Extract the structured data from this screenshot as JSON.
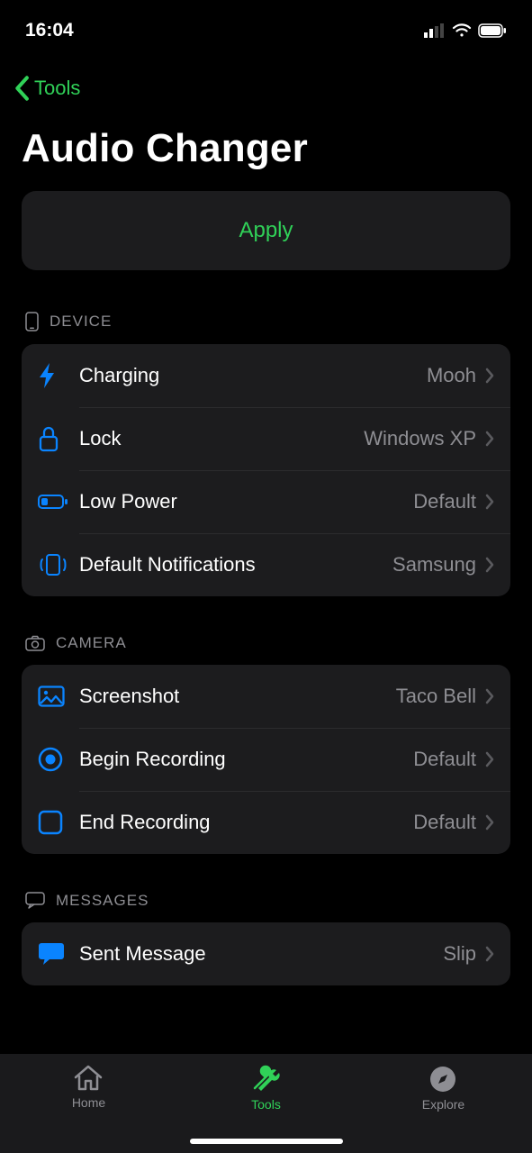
{
  "statusbar": {
    "time": "16:04"
  },
  "nav": {
    "back_label": "Tools"
  },
  "page": {
    "title": "Audio Changer",
    "apply_label": "Apply"
  },
  "sections": {
    "device": {
      "header": "DEVICE",
      "rows": {
        "charging": {
          "label": "Charging",
          "value": "Mooh"
        },
        "lock": {
          "label": "Lock",
          "value": "Windows XP"
        },
        "lowpower": {
          "label": "Low Power",
          "value": "Default"
        },
        "notif": {
          "label": "Default Notifications",
          "value": "Samsung"
        }
      }
    },
    "camera": {
      "header": "CAMERA",
      "rows": {
        "screenshot": {
          "label": "Screenshot",
          "value": "Taco Bell"
        },
        "begin_rec": {
          "label": "Begin Recording",
          "value": "Default"
        },
        "end_rec": {
          "label": "End Recording",
          "value": "Default"
        }
      }
    },
    "messages": {
      "header": "MESSAGES",
      "rows": {
        "sent": {
          "label": "Sent Message",
          "value": "Slip"
        }
      }
    }
  },
  "tabbar": {
    "home": {
      "label": "Home"
    },
    "tools": {
      "label": "Tools"
    },
    "explore": {
      "label": "Explore"
    }
  }
}
